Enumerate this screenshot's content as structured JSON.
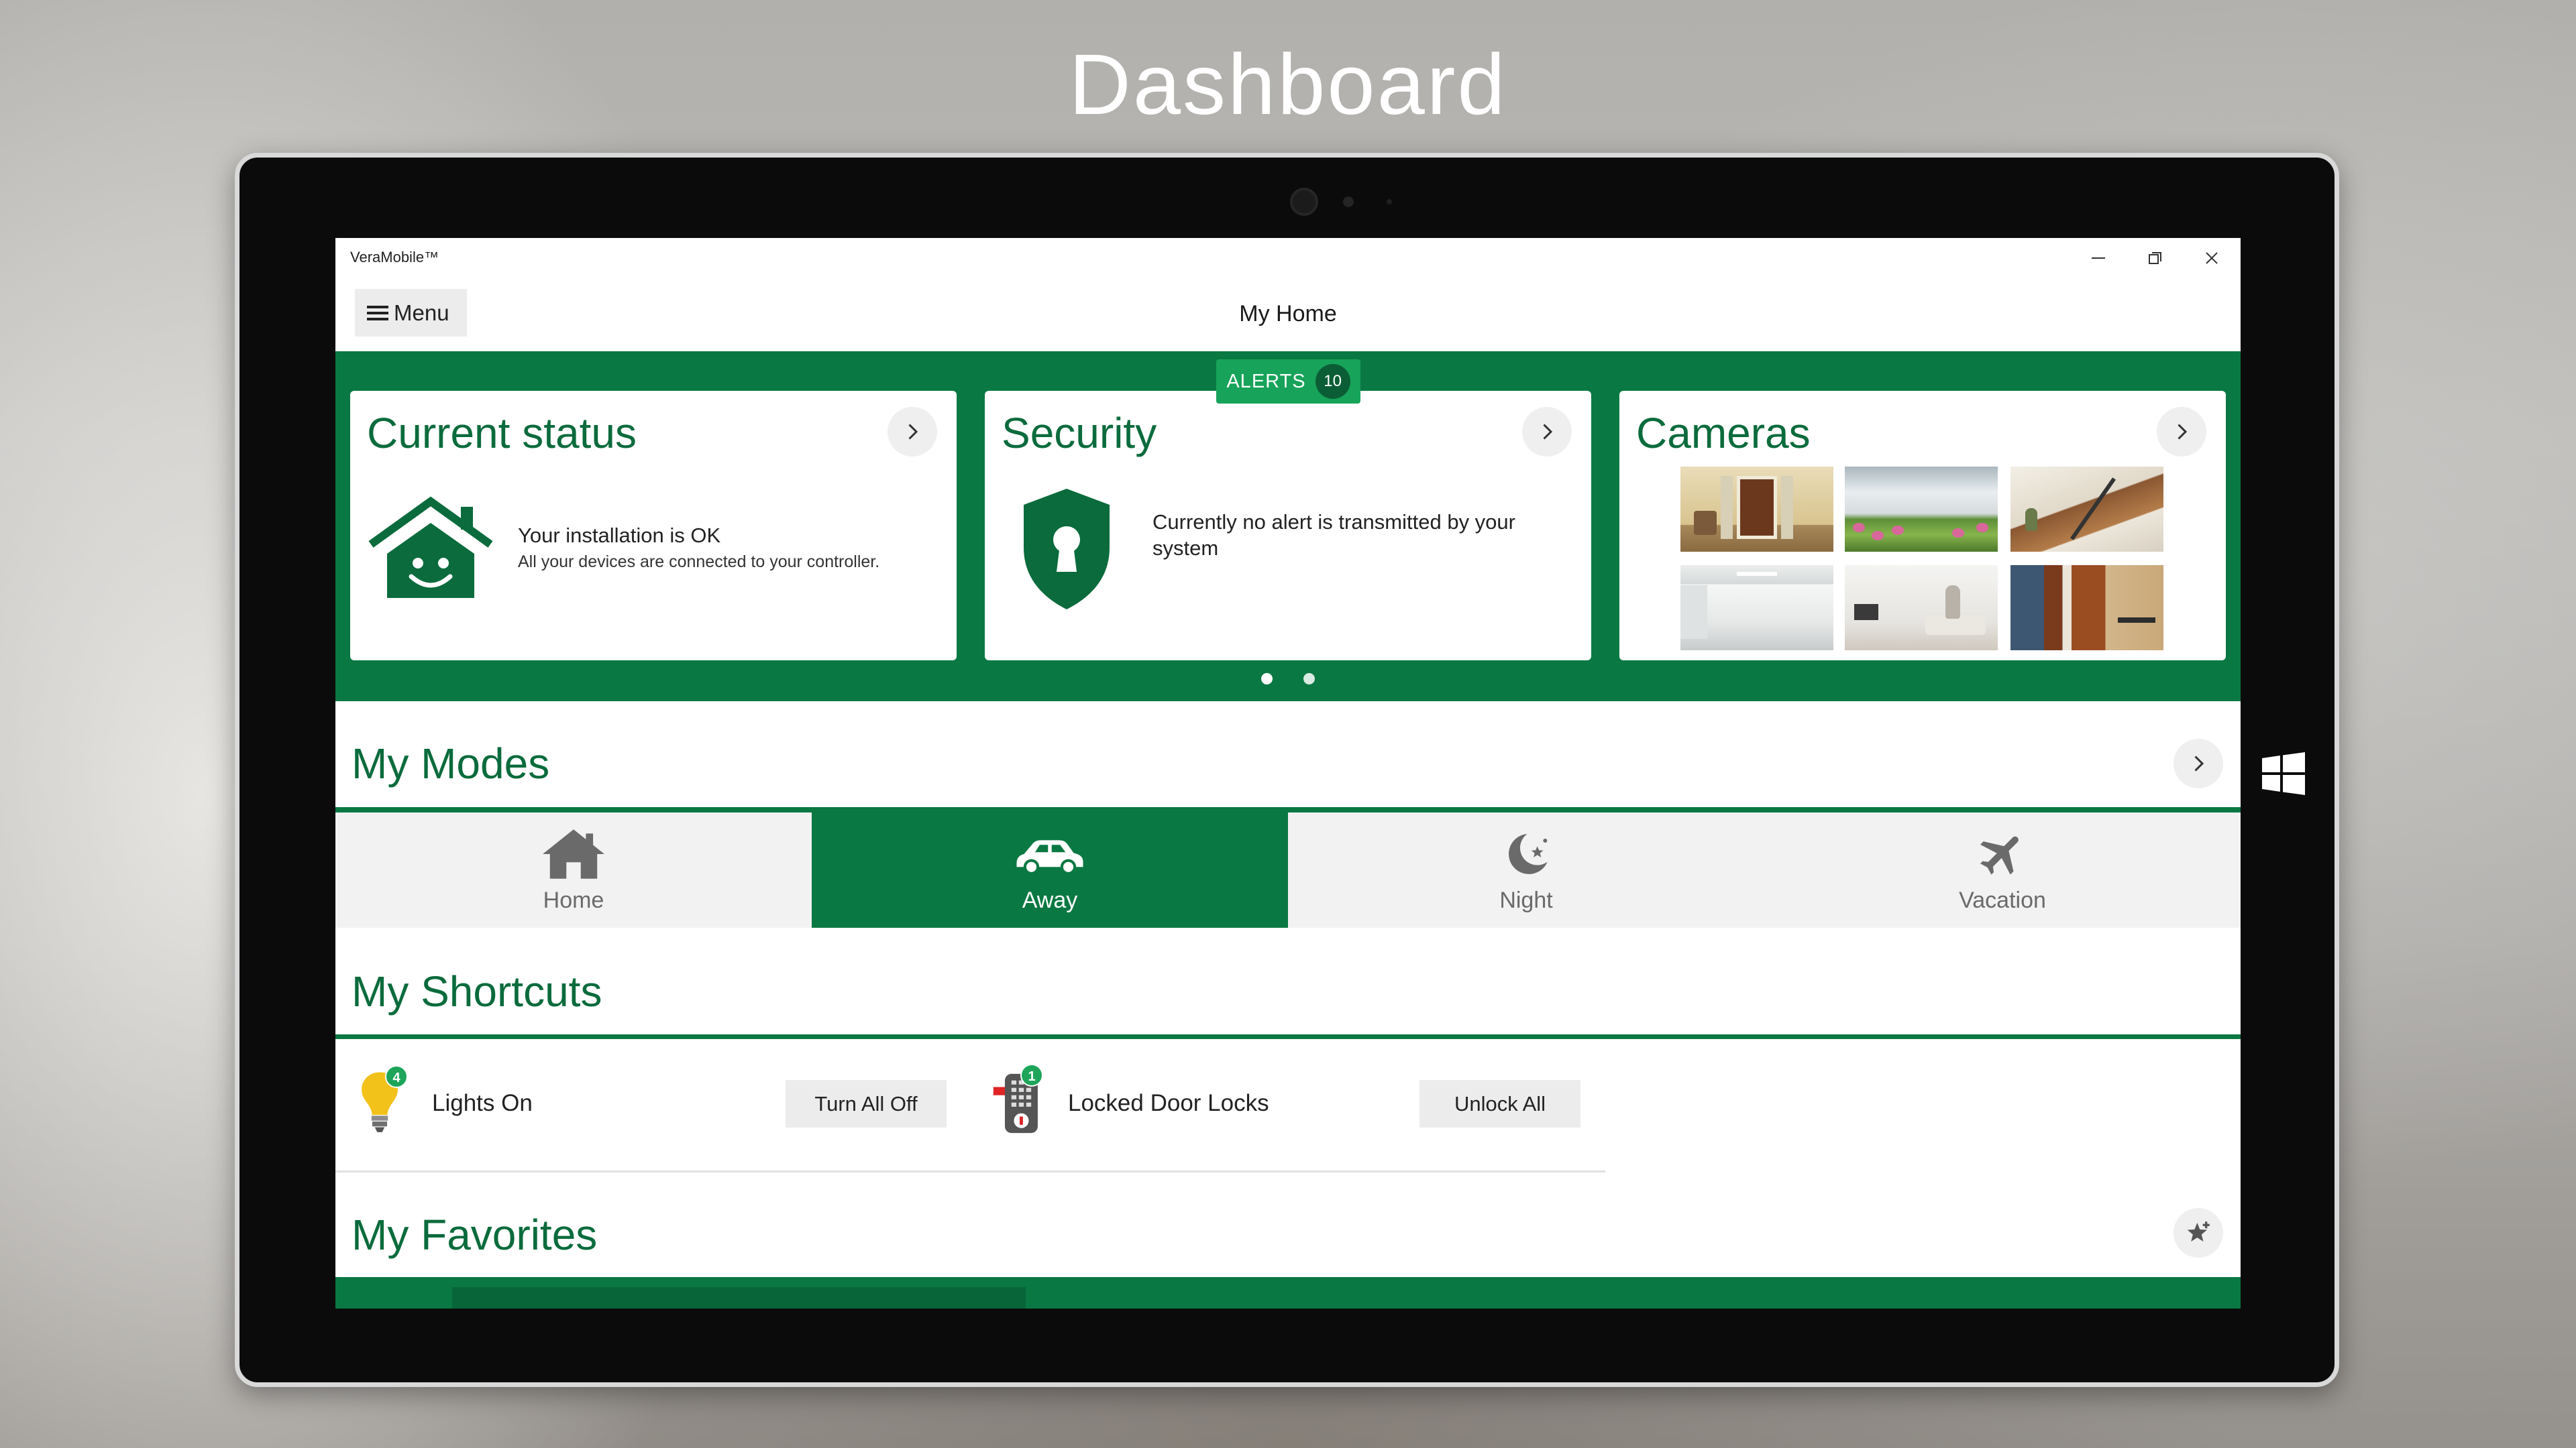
{
  "page_title": "Dashboard",
  "window": {
    "app_title": "VeraMobile™",
    "controls": {
      "minimize_icon": "minimize-icon",
      "restore_icon": "restore-icon",
      "close_icon": "close-icon"
    }
  },
  "header": {
    "menu_label": "Menu",
    "menu_icon": "hamburger-icon",
    "title": "My Home"
  },
  "alerts": {
    "label": "ALERTS",
    "count": "10"
  },
  "cards": {
    "status": {
      "title": "Current status",
      "icon": "smiling-house-icon",
      "headline": "Your installation is OK",
      "detail": "All your devices are connected to your controller."
    },
    "security": {
      "title": "Security",
      "icon": "shield-keyhole-icon",
      "message": "Currently no alert is transmitted by your system"
    },
    "cameras": {
      "title": "Cameras"
    }
  },
  "carousel": {
    "page_count": 2,
    "current_page": 1
  },
  "modes": {
    "title": "My Modes",
    "items": [
      {
        "label": "Home",
        "icon": "home-icon",
        "active": false
      },
      {
        "label": "Away",
        "icon": "car-icon",
        "active": true
      },
      {
        "label": "Night",
        "icon": "moon-icon",
        "active": false
      },
      {
        "label": "Vacation",
        "icon": "airplane-icon",
        "active": false
      }
    ]
  },
  "shortcuts": {
    "title": "My Shortcuts",
    "items": [
      {
        "label": "Lights On",
        "icon": "light-bulb-icon",
        "badge": "4",
        "action_label": "Turn All Off"
      },
      {
        "label": "Locked Door Locks",
        "icon": "door-lock-icon",
        "badge": "1",
        "action_label": "Unlock All"
      }
    ]
  },
  "favorites": {
    "title": "My Favorites",
    "icon": "add-favorite-star-icon"
  },
  "colors": {
    "brand_green": "#0a7842",
    "alert_green": "#17a35a",
    "title_green": "#0b6b3c",
    "mode_bar": "#f2f2f2",
    "bulb_yellow": "#f2c21b"
  }
}
